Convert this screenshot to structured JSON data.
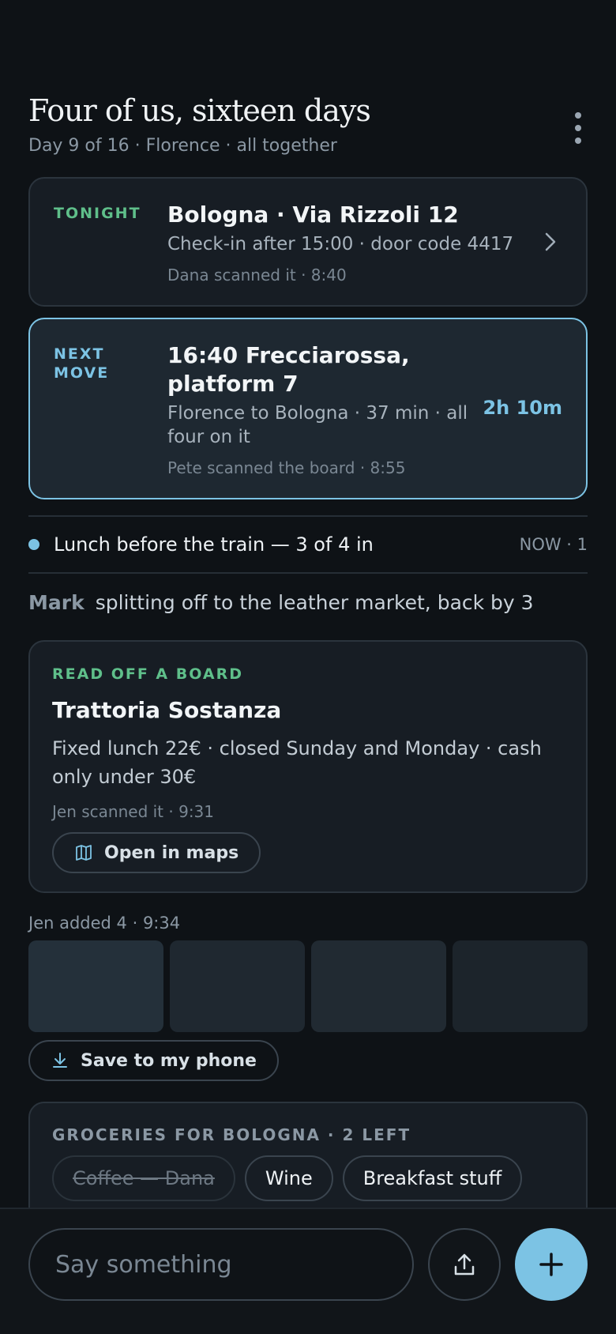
{
  "header": {
    "title": "Four of us, sixteen days",
    "subtitle": "Day 9 of 16 · Florence · all together",
    "more_icon": "more-vertical-icon"
  },
  "tonight": {
    "tag": "TONIGHT",
    "title": "Bologna · Via Rizzoli 12",
    "detail": "Check-in after 15:00 · door code 4417",
    "meta": "Dana scanned it · 8:40",
    "icon": "chevron-right-icon"
  },
  "next_move": {
    "tag": "NEXT MOVE",
    "title": "16:40 Frecciarossa, platform 7",
    "detail": "Florence to Bologna · 37 min · all four on it",
    "meta": "Pete scanned the board · 8:55",
    "eta": "2h 10m"
  },
  "now": {
    "text": "Lunch before the train — 3 of 4 in",
    "badge": "NOW · 1"
  },
  "message": {
    "author": "Mark",
    "text": "splitting off to the leather market, back by 3"
  },
  "board": {
    "tag": "READ OFF A BOARD",
    "title": "Trattoria Sostanza",
    "text": "Fixed lunch 22€ · closed Sunday and Monday · cash only under 30€",
    "meta": "Jen scanned it · 9:31",
    "button_label": "Open in maps",
    "button_icon": "map-icon"
  },
  "photos": {
    "caption": "Jen added 4 · 9:34",
    "count": 4,
    "save_label": "Save to my phone",
    "save_icon": "download-icon"
  },
  "groceries": {
    "tag": "GROCERIES FOR BOLOGNA · 2 LEFT",
    "items": [
      {
        "label": "Coffee — Dana",
        "done": true
      },
      {
        "label": "Wine",
        "done": false
      },
      {
        "label": "Breakfast stuff",
        "done": false
      }
    ]
  },
  "composer": {
    "placeholder": "Say something",
    "share_icon": "share-icon",
    "add_icon": "plus-icon"
  },
  "colors": {
    "background": "#0e1216",
    "accent_blue": "#7cc3e4",
    "accent_green": "#5fbf8a"
  }
}
